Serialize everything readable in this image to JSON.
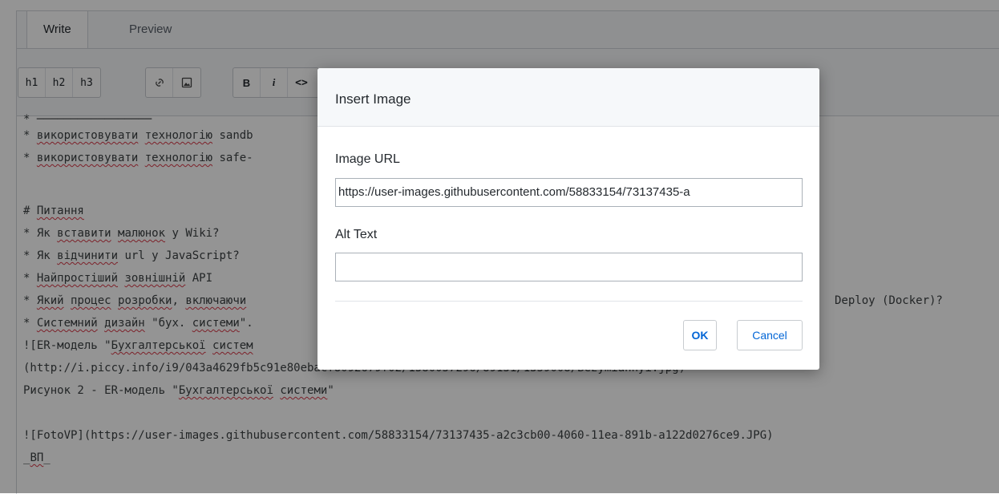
{
  "tabs": {
    "write": "Write",
    "preview": "Preview"
  },
  "toolbar": {
    "h1": "h1",
    "h2": "h2",
    "h3": "h3",
    "link_icon": "link-icon",
    "image_icon": "image-icon",
    "bold": "B",
    "italic": "i",
    "code": "<>"
  },
  "editor": {
    "lines": [
      "* використовувати технологію sandb",
      "* використовувати технологію safe-",
      "",
      "# Питання",
      "* Як вставити малюнок у Wiki?",
      "* Як відчинити url у JavaScript?",
      "* Найпростіший зовнішній API",
      "* Який процес розробки, включаючи",
      "* Системний дизайн \"бух. системи\".",
      "![ER-модель \"Бухгалтерської систем",
      "(http://i.piccy.info/i9/043a4629fb5c91e80ebacf8092679f02/1580057296/89131/1359008/Bezymiannyi.jpg)",
      "Рисунок 2 - ER-модель \"Бухгалтерської системи\"",
      "",
      "![FotoVP](https://user-images.githubusercontent.com/58833154/73137435-a2c3cb00-4060-11ea-891b-a122d0276ce9.JPG)",
      "_ВП_"
    ],
    "line_8_tail": "Deploy (Docker)?"
  },
  "modal": {
    "title": "Insert Image",
    "url_label": "Image URL",
    "url_value": "https://user-images.githubusercontent.com/58833154/73137435-a",
    "alt_label": "Alt Text",
    "alt_value": "",
    "ok_label": "OK",
    "cancel_label": "Cancel"
  }
}
